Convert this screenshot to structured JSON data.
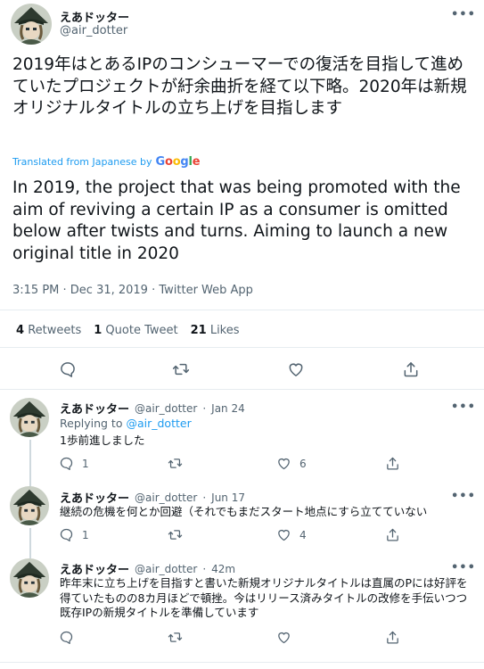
{
  "main": {
    "display_name": "えあドッター",
    "handle": "@air_dotter",
    "text_jp": "2019年はとあるIPのコンシューマーでの復活を目指して進めていたプロジェクトが紆余曲折を経て以下略。2020年は新規オリジナルタイトルの立ち上げを目指します",
    "translated_label": "Translated from Japanese by",
    "translated_brand": "Google",
    "text_en": "In 2019, the project that was being promoted with the aim of reviving a certain IP as a consumer is omitted below after twists and turns. Aiming to launch a new original title in 2020",
    "meta": "3:15 PM · Dec 31, 2019 · Twitter Web App",
    "stats": {
      "retweets_count": "4",
      "retweets_label": "Retweets",
      "quotes_count": "1",
      "quotes_label": "Quote Tweet",
      "likes_count": "21",
      "likes_label": "Likes"
    },
    "more": "•••"
  },
  "replies": [
    {
      "display_name": "えあドッター",
      "handle": "@air_dotter",
      "sep": "·",
      "time": "Jan 24",
      "replying_prefix": "Replying to",
      "replying_handle": "@air_dotter",
      "text": "1歩前進しました",
      "reply_count": "1",
      "like_count": "6",
      "more": "•••"
    },
    {
      "display_name": "えあドッター",
      "handle": "@air_dotter",
      "sep": "·",
      "time": "Jun 17",
      "text": "継続の危機を何とか回避（それでもまだスタート地点にすら立てていない",
      "reply_count": "1",
      "like_count": "4",
      "more": "•••"
    },
    {
      "display_name": "えあドッター",
      "handle": "@air_dotter",
      "sep": "·",
      "time": "42m",
      "text": "昨年末に立ち上げを目指すと書いた新規オリジナルタイトルは直属のPには好評を得ていたものの8カ月ほどで頓挫。今はリリース済みタイトルの改修を手伝いつつ既存IPの新規タイトルを準備しています",
      "more": "•••"
    }
  ],
  "colors": {
    "link_blue": "#1d9bf0",
    "secondary_gray": "#536471",
    "divider": "#e6ecf0"
  },
  "icons": [
    "reply-icon",
    "retweet-icon",
    "like-icon",
    "share-icon"
  ]
}
